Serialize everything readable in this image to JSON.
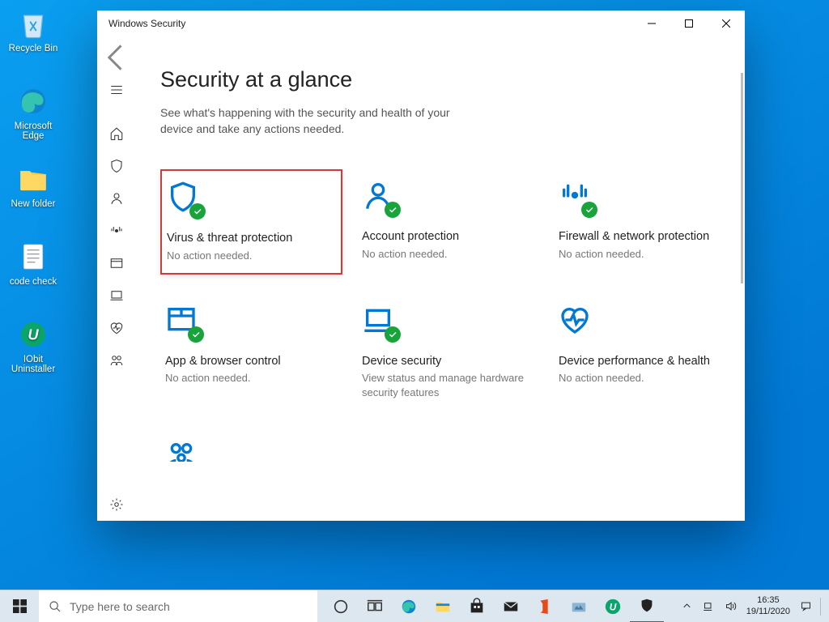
{
  "desktop": {
    "icons": [
      {
        "label": "Recycle Bin"
      },
      {
        "label": "Microsoft Edge"
      },
      {
        "label": "New folder"
      },
      {
        "label": "code check"
      },
      {
        "label": "IObit Uninstaller"
      }
    ]
  },
  "window": {
    "title": "Windows Security",
    "page_title": "Security at a glance",
    "page_subtitle": "See what's happening with the security and health of your device and take any actions needed.",
    "tiles": [
      {
        "title": "Virus & threat protection",
        "sub": "No action needed.",
        "badge": true,
        "highlight": true
      },
      {
        "title": "Account protection",
        "sub": "No action needed.",
        "badge": true
      },
      {
        "title": "Firewall & network protection",
        "sub": "No action needed.",
        "badge": true
      },
      {
        "title": "App & browser control",
        "sub": "No action needed.",
        "badge": true
      },
      {
        "title": "Device security",
        "sub": "View status and manage hardware security features",
        "badge": true
      },
      {
        "title": "Device performance & health",
        "sub": "No action needed.",
        "badge": false
      }
    ]
  },
  "taskbar": {
    "search_placeholder": "Type here to search",
    "time": "16:35",
    "date": "19/11/2020"
  }
}
